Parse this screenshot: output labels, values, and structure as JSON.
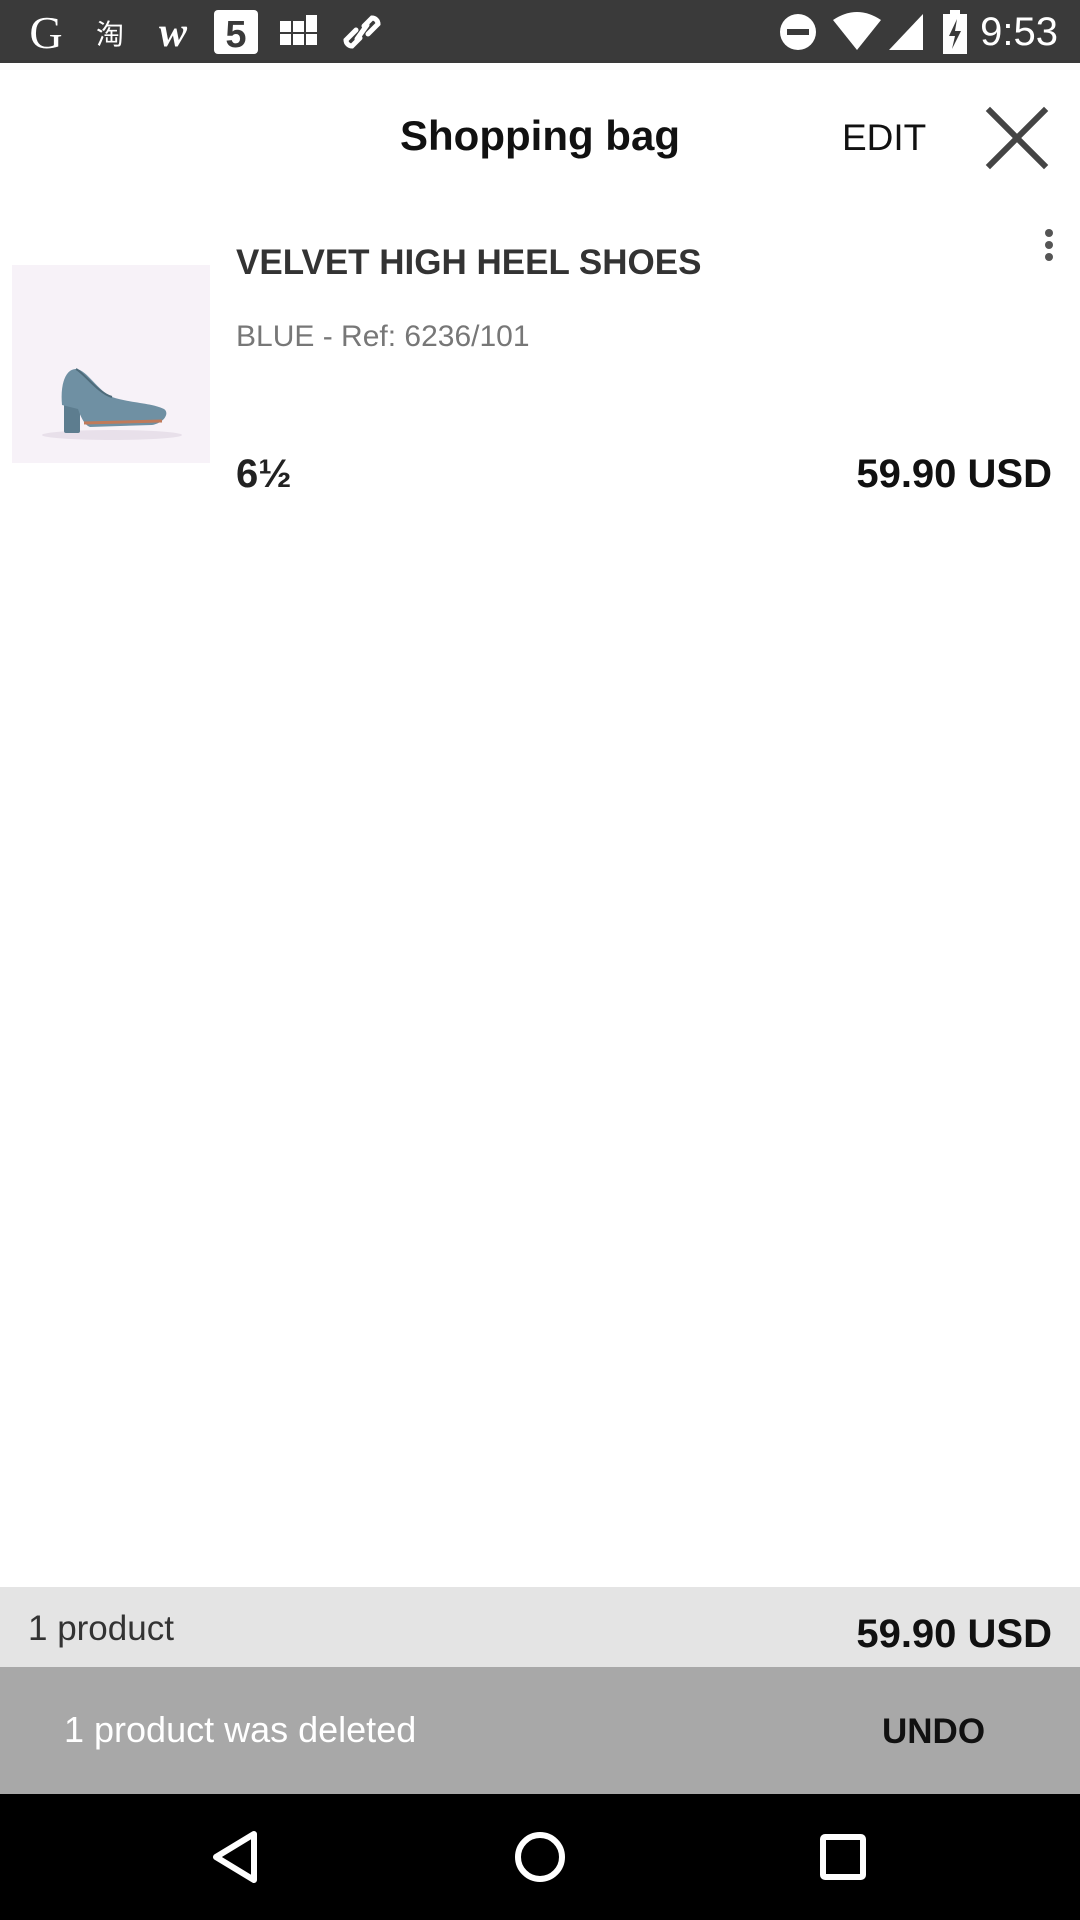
{
  "status_bar": {
    "time": "9:53",
    "left_icons": [
      "google-icon",
      "taobao-icon",
      "wish-icon",
      "html5-icon",
      "grid-app-icon",
      "link-icon"
    ],
    "right_icons": [
      "do-not-disturb-icon",
      "wifi-icon",
      "signal-icon",
      "battery-charging-icon"
    ]
  },
  "header": {
    "title": "Shopping bag",
    "edit_label": "EDIT",
    "close_icon": "close-icon"
  },
  "product": {
    "name": "VELVET HIGH HEEL SHOES",
    "ref": "BLUE - Ref: 6236/101",
    "size": "6½",
    "price": "59.90 USD",
    "image_icon": "shoe-image",
    "menu_icon": "more-vert-icon"
  },
  "summary": {
    "count": "1 product",
    "total": "59.90 USD"
  },
  "snackbar": {
    "message": "1 product was deleted",
    "action": "UNDO"
  },
  "nav_bar": {
    "icons": [
      "back-icon",
      "home-icon",
      "recents-icon"
    ]
  },
  "colors": {
    "status_bar_bg": "#3a3a3a",
    "summary_bg": "#e4e4e4",
    "snackbar_bg": "#a8a8a8",
    "nav_bar_bg": "#000000"
  }
}
